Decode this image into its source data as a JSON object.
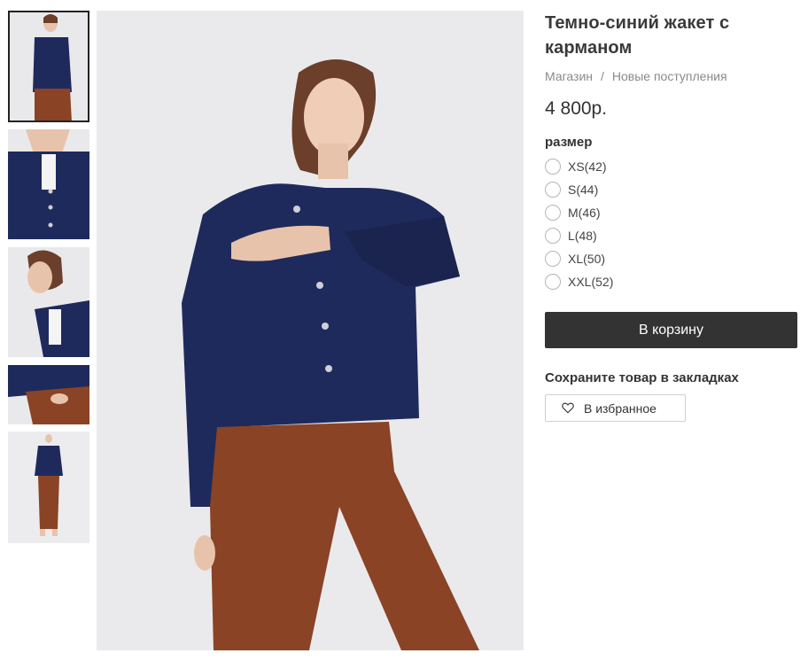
{
  "product": {
    "title": "Темно-синий жакет с карманом",
    "price": "4 800р."
  },
  "breadcrumb": {
    "items": [
      "Магазин",
      "Новые поступления"
    ],
    "separator": "/"
  },
  "size": {
    "label": "размер",
    "options": [
      "XS(42)",
      "S(44)",
      "M(46)",
      "L(48)",
      "XL(50)",
      "XXL(52)"
    ]
  },
  "actions": {
    "cart_label": "В корзину",
    "save_label": "Сохраните товар в закладках",
    "favorite_label": "В избранное"
  },
  "colors": {
    "jacket": "#1f2a5c",
    "pants": "#8a4325",
    "background": "#e9e9ec",
    "button_dark": "#333333"
  },
  "icons": {
    "favorite": "heart-outline-icon"
  }
}
